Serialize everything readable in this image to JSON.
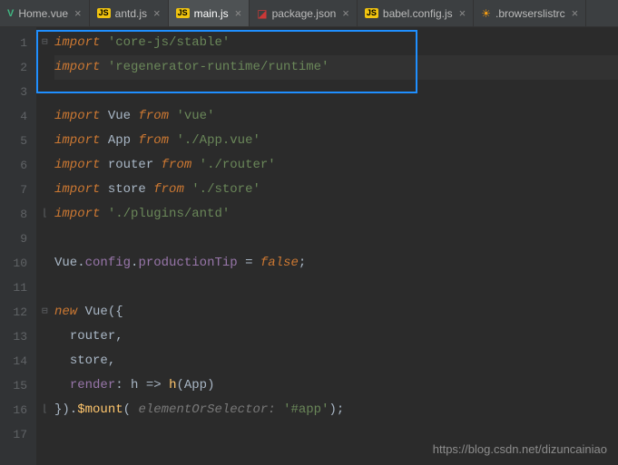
{
  "tabs": [
    {
      "icon": "vue",
      "label": "Home.vue",
      "active": false
    },
    {
      "icon": "js",
      "label": "antd.js",
      "active": false
    },
    {
      "icon": "js",
      "label": "main.js",
      "active": true
    },
    {
      "icon": "json",
      "label": "package.json",
      "active": false
    },
    {
      "icon": "js",
      "label": "babel.config.js",
      "active": false
    },
    {
      "icon": "sun",
      "label": ".browserslistrc",
      "active": false
    }
  ],
  "glyphs": {
    "vue": "V",
    "js": "JS",
    "json": "◪",
    "sun": "☀",
    "close": "×",
    "fold_minus": "⊟",
    "fold_plus_l": "⌊",
    "fold_plus_r": "⌉"
  },
  "code": {
    "l1": {
      "kw": "import",
      "str": "'core-js/stable'"
    },
    "l2": {
      "kw": "import",
      "str": "'regenerator-runtime/runtime'"
    },
    "l4": {
      "kw": "import",
      "ident": "Vue",
      "from": "from",
      "str": "'vue'"
    },
    "l5": {
      "kw": "import",
      "ident": "App",
      "from": "from",
      "str": "'./App.vue'"
    },
    "l6": {
      "kw": "import",
      "ident": "router",
      "from": "from",
      "str": "'./router'"
    },
    "l7": {
      "kw": "import",
      "ident": "store",
      "from": "from",
      "str": "'./store'"
    },
    "l8": {
      "kw": "import",
      "str": "'./plugins/antd'"
    },
    "l10_a": "Vue",
    "l10_b": "config",
    "l10_c": "productionTip",
    "l10_eq": " = ",
    "l10_false": "false",
    "l10_semi": ";",
    "l12_new": "new",
    "l12_vue": "Vue",
    "l12_open": "({",
    "l13": "router",
    "l13_comma": ",",
    "l14": "store",
    "l14_comma": ",",
    "l15_render": "render",
    "l15_colon": ": ",
    "l15_h1": "h",
    "l15_arrow": " => ",
    "l15_h2": "h",
    "l15_p1": "(",
    "l15_app": "App",
    "l15_p2": ")",
    "l16_close": "}).",
    "l16_mount": "$mount",
    "l16_p1": "(",
    "l16_hint": " elementOrSelector: ",
    "l16_str": "'#app'",
    "l16_p2": ");"
  },
  "watermark": "https://blog.csdn.net/dizuncainiao"
}
